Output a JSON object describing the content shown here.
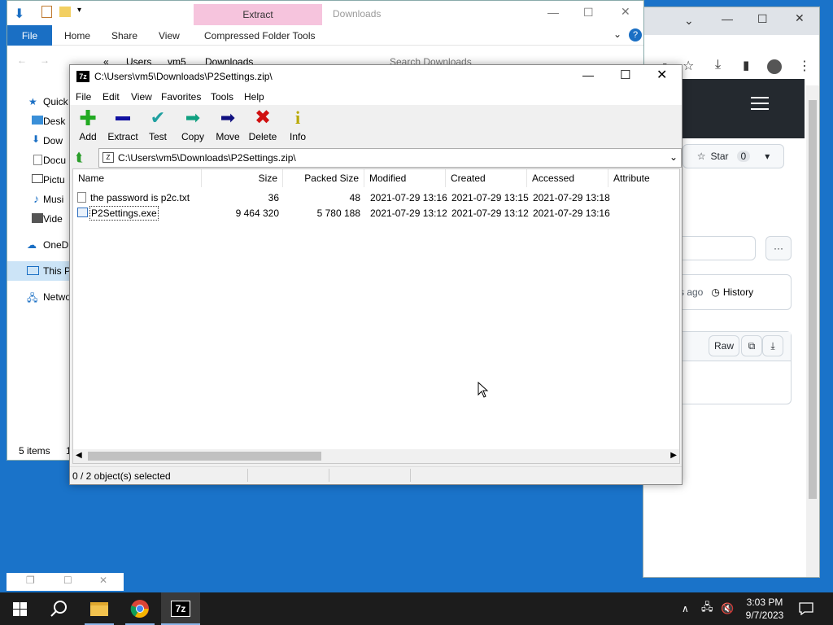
{
  "chrome": {
    "star_label": "Star",
    "star_count": "0",
    "history_label": "History",
    "ago_text": "rs ago",
    "raw_label": "Raw"
  },
  "explorer": {
    "tabs": {
      "file": "File",
      "home": "Home",
      "share": "Share",
      "view": "View",
      "compressed": "Compressed Folder Tools"
    },
    "context_tab": "Extract",
    "window_title": "Downloads",
    "breadcrumb": [
      "Users",
      "vm5",
      "Downloads"
    ],
    "search_placeholder": "Search Downloads",
    "nav_items": [
      "Quick",
      "Desk",
      "Dow",
      "Docu",
      "Pictu",
      "Musi",
      "Vide",
      "OneDr",
      "This P",
      "Netwo"
    ],
    "status": "5 items",
    "status_frag": "1"
  },
  "sevenzip": {
    "title": "C:\\Users\\vm5\\Downloads\\P2Settings.zip\\",
    "app_icon": "7z",
    "menu": [
      "File",
      "Edit",
      "View",
      "Favorites",
      "Tools",
      "Help"
    ],
    "toolbar": [
      {
        "label": "Add",
        "icon": "plus-icon",
        "color": "#22aa22"
      },
      {
        "label": "Extract",
        "icon": "minus-icon",
        "color": "#1010a0"
      },
      {
        "label": "Test",
        "icon": "check-icon",
        "color": "#20a0a0"
      },
      {
        "label": "Copy",
        "icon": "double-arrow-icon",
        "color": "#10a080"
      },
      {
        "label": "Move",
        "icon": "arrow-right-icon",
        "color": "#101080"
      },
      {
        "label": "Delete",
        "icon": "x-icon",
        "color": "#d01010"
      },
      {
        "label": "Info",
        "icon": "info-icon",
        "color": "#c0b000"
      }
    ],
    "address": "C:\\Users\\vm5\\Downloads\\P2Settings.zip\\",
    "columns": [
      "Name",
      "Size",
      "Packed Size",
      "Modified",
      "Created",
      "Accessed",
      "Attribute"
    ],
    "rows": [
      {
        "name": "the password is p2c.txt",
        "size": "36",
        "packed": "48",
        "modified": "2021-07-29 13:16",
        "created": "2021-07-29 13:15",
        "accessed": "2021-07-29 13:18"
      },
      {
        "name": "P2Settings.exe",
        "size": "9 464 320",
        "packed": "5 780 188",
        "modified": "2021-07-29 13:12",
        "created": "2021-07-29 13:12",
        "accessed": "2021-07-29 13:16"
      }
    ],
    "status": "0 / 2 object(s) selected"
  },
  "taskbar": {
    "time": "3:03 PM",
    "date": "9/7/2023",
    "sevenzip_label": "7z"
  },
  "colors": {
    "desktop": "#1a73c9",
    "file_tab": "#1a6fc4",
    "extract_ctx": "#f6c4dd",
    "taskbar": "#1c1c1c"
  }
}
